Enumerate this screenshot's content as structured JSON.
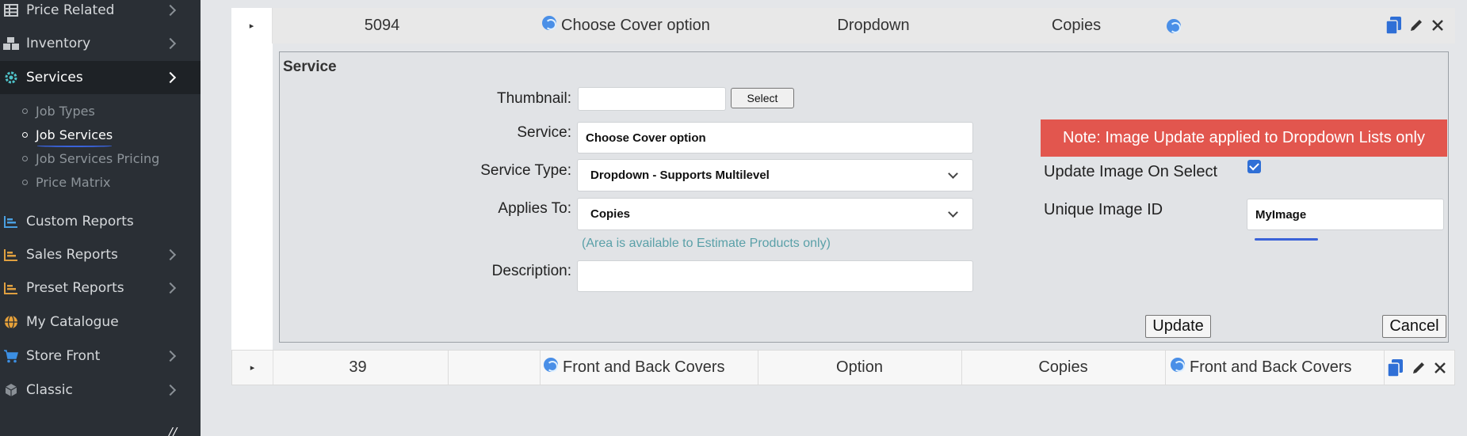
{
  "sidebar": {
    "items": [
      {
        "label": "Price Related",
        "icon": "table-icon",
        "has_chevron": true
      },
      {
        "label": "Inventory",
        "icon": "boxes-icon",
        "has_chevron": true
      },
      {
        "label": "Services",
        "icon": "gear-icon",
        "has_chevron": true,
        "active": true
      },
      {
        "label": "Custom Reports",
        "icon": "bar-chart-icon",
        "has_chevron": false
      },
      {
        "label": "Sales Reports",
        "icon": "bar-chart-icon",
        "has_chevron": true
      },
      {
        "label": "Preset Reports",
        "icon": "bar-chart-icon",
        "has_chevron": true
      },
      {
        "label": "My Catalogue",
        "icon": "globe-icon",
        "has_chevron": false
      },
      {
        "label": "Store Front",
        "icon": "cart-icon",
        "has_chevron": true
      },
      {
        "label": "Classic",
        "icon": "cube-icon",
        "has_chevron": true
      }
    ],
    "sub_items": [
      {
        "label": "Job Types"
      },
      {
        "label": "Job Services",
        "active": true
      },
      {
        "label": "Job Services Pricing"
      },
      {
        "label": "Price Matrix"
      }
    ]
  },
  "table": {
    "row1": {
      "id": "5094",
      "service": "Choose Cover option",
      "type": "Dropdown",
      "applies_to": "Copies",
      "image_name": ""
    },
    "row2": {
      "id": "39",
      "col2": "",
      "service": "Front and Back Covers",
      "type": "Option",
      "applies_to": "Copies",
      "image_name": "Front and Back Covers"
    }
  },
  "form": {
    "title": "Service",
    "thumbnail_label": "Thumbnail:",
    "thumbnail_value": "",
    "select_button": "Select",
    "service_label": "Service:",
    "service_value": "Choose Cover option",
    "service_type_label": "Service Type:",
    "service_type_value": "Dropdown - Supports Multilevel",
    "applies_to_label": "Applies To:",
    "applies_to_value": "Copies",
    "area_hint": "(Area is available to Estimate Products only)",
    "description_label": "Description:",
    "description_value": "",
    "note": "Note: Image Update applied to Dropdown Lists only",
    "update_image_label": "Update Image On Select",
    "update_image_checked": true,
    "unique_id_label": "Unique Image ID",
    "unique_id_value": "MyImage",
    "update_button": "Update",
    "cancel_button": "Cancel"
  },
  "colors": {
    "sidebar_bg": "#2a2f35",
    "note_bg": "#e2564e",
    "accent_blue": "#2f6fd6",
    "hint": "#5aa0a8"
  }
}
